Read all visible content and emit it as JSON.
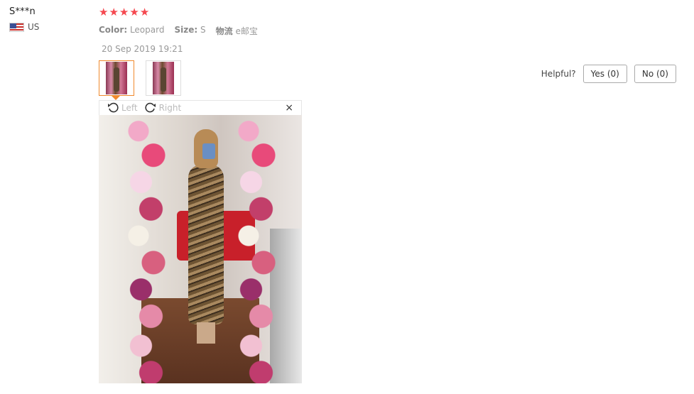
{
  "reviewer": {
    "name": "S***n",
    "country": "US",
    "flag_icon": "us-flag-icon"
  },
  "review": {
    "rating": 5,
    "stars": [
      "★",
      "★",
      "★",
      "★",
      "★"
    ],
    "star_color": "#f5484f",
    "attributes": [
      {
        "key": "Color:",
        "value": "Leopard"
      },
      {
        "key": "Size:",
        "value": "S"
      },
      {
        "key": "物流",
        "value": "e邮宝"
      }
    ],
    "date": "20 Sep 2019 19:21"
  },
  "helpful": {
    "label": "Helpful?",
    "yes": "Yes (0)",
    "no": "No (0)"
  },
  "viewer": {
    "rotate_left": "Left",
    "rotate_right": "Right",
    "close": "×"
  },
  "accent_color": "#f08a2e"
}
